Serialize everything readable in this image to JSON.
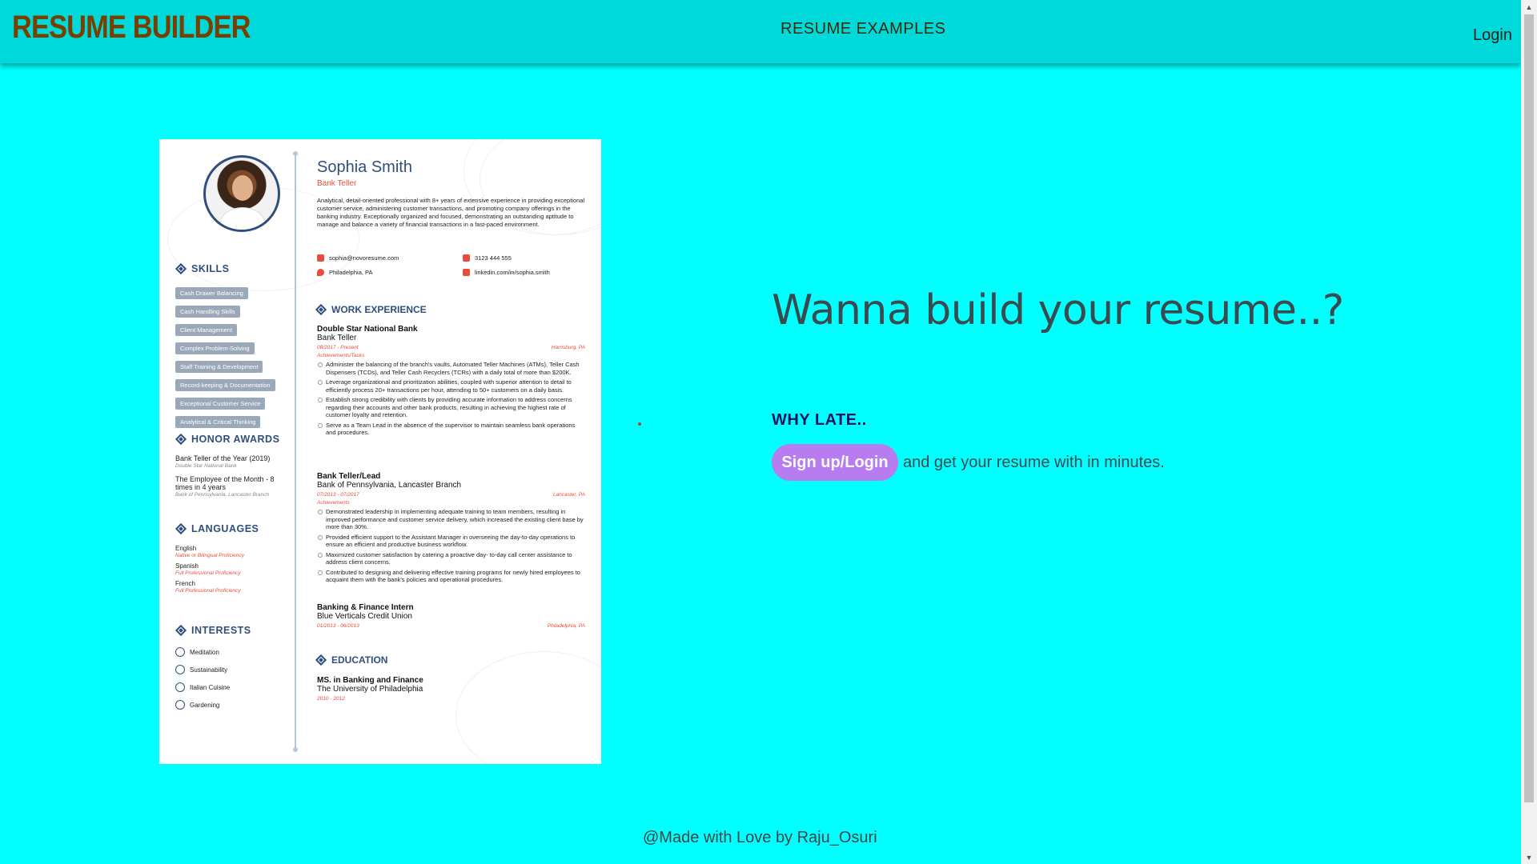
{
  "header": {
    "brand": "RESUME BUILDER",
    "examples_link": "RESUME EXAMPLES",
    "login_link": "Login"
  },
  "resume": {
    "name": "Sophia Smith",
    "role": "Bank Teller",
    "summary": "Analytical, detail-oriented professional with 8+ years of extensive experience in providing exceptional customer service, administering customer transactions, and promoting company offerings in the banking industry. Exceptionally organized and focused, demonstrating an outstanding aptitude to manage and balance a variety of financial transactions in a fast-paced environment.",
    "contact": {
      "email": "sophia@novoresume.com",
      "phone": "3123 444 555",
      "location": "Philadelphia, PA",
      "linkedin": "linkedin.com/in/sophia.smith"
    },
    "skills_title": "SKILLS",
    "skills": [
      "Cash Drawer Balancing",
      "Cash Handling Skills",
      "Client Management",
      "Complex Problem-Solving",
      "Staff Training & Development",
      "Record-keeping & Documentation",
      "Exceptional Customer Service",
      "Analytical & Critical Thinking"
    ],
    "awards_title": "HONOR AWARDS",
    "awards": [
      {
        "title": "Bank Teller of the Year (2019)",
        "org": "Double Star National Bank"
      },
      {
        "title": "The Employee of the Month - 8 times in 4 years",
        "org": "Bank of Pennsylvania, Lancaster Branch"
      }
    ],
    "languages_title": "LANGUAGES",
    "languages": [
      {
        "name": "English",
        "level": "Native or Bilingual Proficiency"
      },
      {
        "name": "Spanish",
        "level": "Full Professional Proficiency"
      },
      {
        "name": "French",
        "level": "Full Professional Proficiency"
      }
    ],
    "interests_title": "INTERESTS",
    "interests": [
      "Meditation",
      "Sustainability",
      "Italian Cuisine",
      "Gardening"
    ],
    "work_title": "WORK EXPERIENCE",
    "jobs": [
      {
        "company": "Double Star National Bank",
        "title": "Bank Teller",
        "dates": "08/2017 - Present",
        "location": "Harrisburg, PA",
        "ach_label": "Achievements/Tasks",
        "bullets": [
          "Administer the balancing of the branch's vaults, Automated Teller Machines (ATMs), Teller Cash Dispensers (TCDs), and Teller Cash Recyclers (TCRs) with a daily total of more than $200K.",
          "Leverage organizational and prioritization abilities, coupled with superior attention to detail to efficiently process 20+ transactions per hour, attending to 50+ customers on a daily basis.",
          "Establish strong credibility with clients by providing accurate information to address concerns regarding their accounts and other bank products, resulting in achieving the highest rate of customer loyalty and retention.",
          "Serve as a Team Lead in the absence of the supervisor to maintain seamless bank operations and procedures."
        ]
      },
      {
        "company": "Bank Teller/Lead",
        "title": "Bank of Pennsylvania, Lancaster Branch",
        "dates": "07/2013 - 07/2017",
        "location": "Lancaster, PA",
        "ach_label": "Achievements",
        "bullets": [
          "Demonstrated leadership in implementing adequate training to team members, resulting in improved performance and customer service delivery, which increased the existing client base by more than 30%.",
          "Provided efficient support to the Assistant Manager in overseeing the day-to-day operations to ensure an efficient and productive business workflow.",
          "Maximized customer satisfaction by catering a proactive day- to-day call center assistance to address client concerns.",
          "Contributed to designing and delivering effective training programs for newly hired employees to acquaint them with the bank's policies and operational procedures."
        ]
      },
      {
        "company": "Banking & Finance Intern",
        "title": "Blue Verticals Credit Union",
        "dates": "01/2013 - 06/2013",
        "location": "Philadelphia, PA",
        "ach_label": "",
        "bullets": []
      }
    ],
    "education_title": "EDUCATION",
    "education": {
      "degree": "MS. in Banking and Finance",
      "school": "The University of Philadelphia",
      "dates": "2010 - 2012"
    }
  },
  "hero": {
    "title": "Wanna build your resume..?",
    "why": "WHY LATE..",
    "signup_label": "Sign up/Login",
    "tail": "and get your resume with in minutes."
  },
  "footer": {
    "text": "@Made with Love by Raju_Osuri"
  },
  "colors": {
    "background": "#00ffff",
    "header": "#00d9d9",
    "brand": "#7a3f00",
    "signup_button": "#b77cf0",
    "resume_accent": "#2e4f7c",
    "resume_red": "#e74c3c"
  },
  "icons": [
    "scroll-up-arrow-icon",
    "scroll-down-arrow-icon",
    "diamond-section-icon",
    "email-icon",
    "phone-icon",
    "location-icon",
    "linkedin-icon"
  ]
}
